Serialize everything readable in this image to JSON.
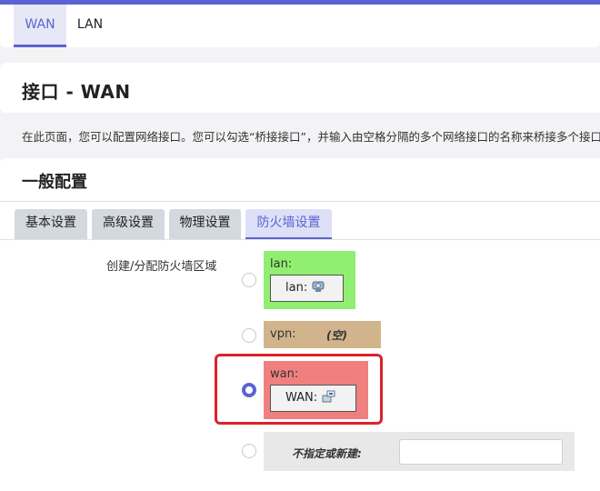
{
  "top_tabs": [
    {
      "label": "WAN",
      "active": true
    },
    {
      "label": "LAN",
      "active": false
    }
  ],
  "page_title": "接口 - WAN",
  "description": "在此页面，您可以配置网络接口。您可以勾选“桥接接口”，并输入由空格分隔的多个网络接口的名称来桥接多个接口。",
  "section_title": "一般配置",
  "sub_tabs": [
    {
      "label": "基本设置",
      "active": false
    },
    {
      "label": "高级设置",
      "active": false
    },
    {
      "label": "物理设置",
      "active": false
    },
    {
      "label": "防火墙设置",
      "active": true
    }
  ],
  "firewall": {
    "field_label": "创建/分配防火墙区域",
    "zones": [
      {
        "name": "lan:",
        "network": "lan:",
        "icon": "ethernet-icon",
        "color": "#90ee70",
        "selected": false
      },
      {
        "name": "vpn:",
        "empty_text": "(空)",
        "color": "#d2b48c",
        "selected": false
      },
      {
        "name": "wan:",
        "network": "WAN:",
        "icon": "network-port-icon",
        "color": "#f08080",
        "selected": true
      }
    ],
    "custom": {
      "label": "不指定或新建:",
      "value": "",
      "placeholder": ""
    }
  },
  "colors": {
    "accent": "#5b63d3",
    "highlight_border": "#d9232b"
  }
}
